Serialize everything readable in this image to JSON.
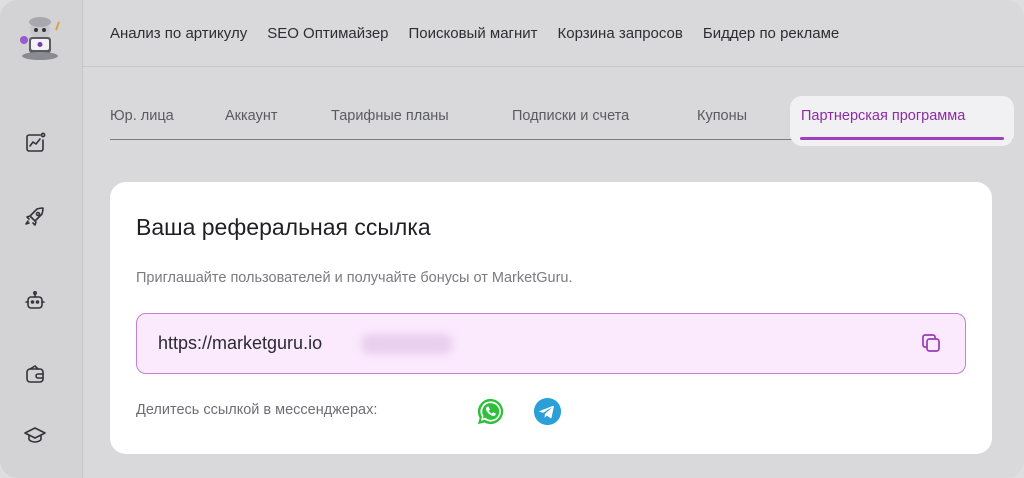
{
  "topnav": {
    "items": [
      "Анализ по артикулу",
      "SEO Оптимайзер",
      "Поисковый магнит",
      "Корзина запросов",
      "Биддер по рекламе"
    ]
  },
  "sidebar": {
    "icons": [
      "analytics-icon",
      "rocket-icon",
      "robot-icon",
      "wallet-icon",
      "graduation-cap-icon"
    ]
  },
  "tabs": {
    "items": [
      "Юр. лица",
      "Аккаунт",
      "Тарифные планы",
      "Подписки и счета",
      "Купоны"
    ],
    "active": "Партнерская программа"
  },
  "referral": {
    "title": "Ваша реферальная ссылка",
    "description": "Приглашайте пользователей и получайте бонусы от MarketGuru.",
    "link": "https://marketguru.io",
    "share_label": "Делитесь ссылкой в мессенджерах:"
  },
  "colors": {
    "accent": "#a23dbd",
    "field_bg": "#fbe9fd",
    "whatsapp": "#2fbf3c",
    "telegram": "#2a9fd8"
  }
}
